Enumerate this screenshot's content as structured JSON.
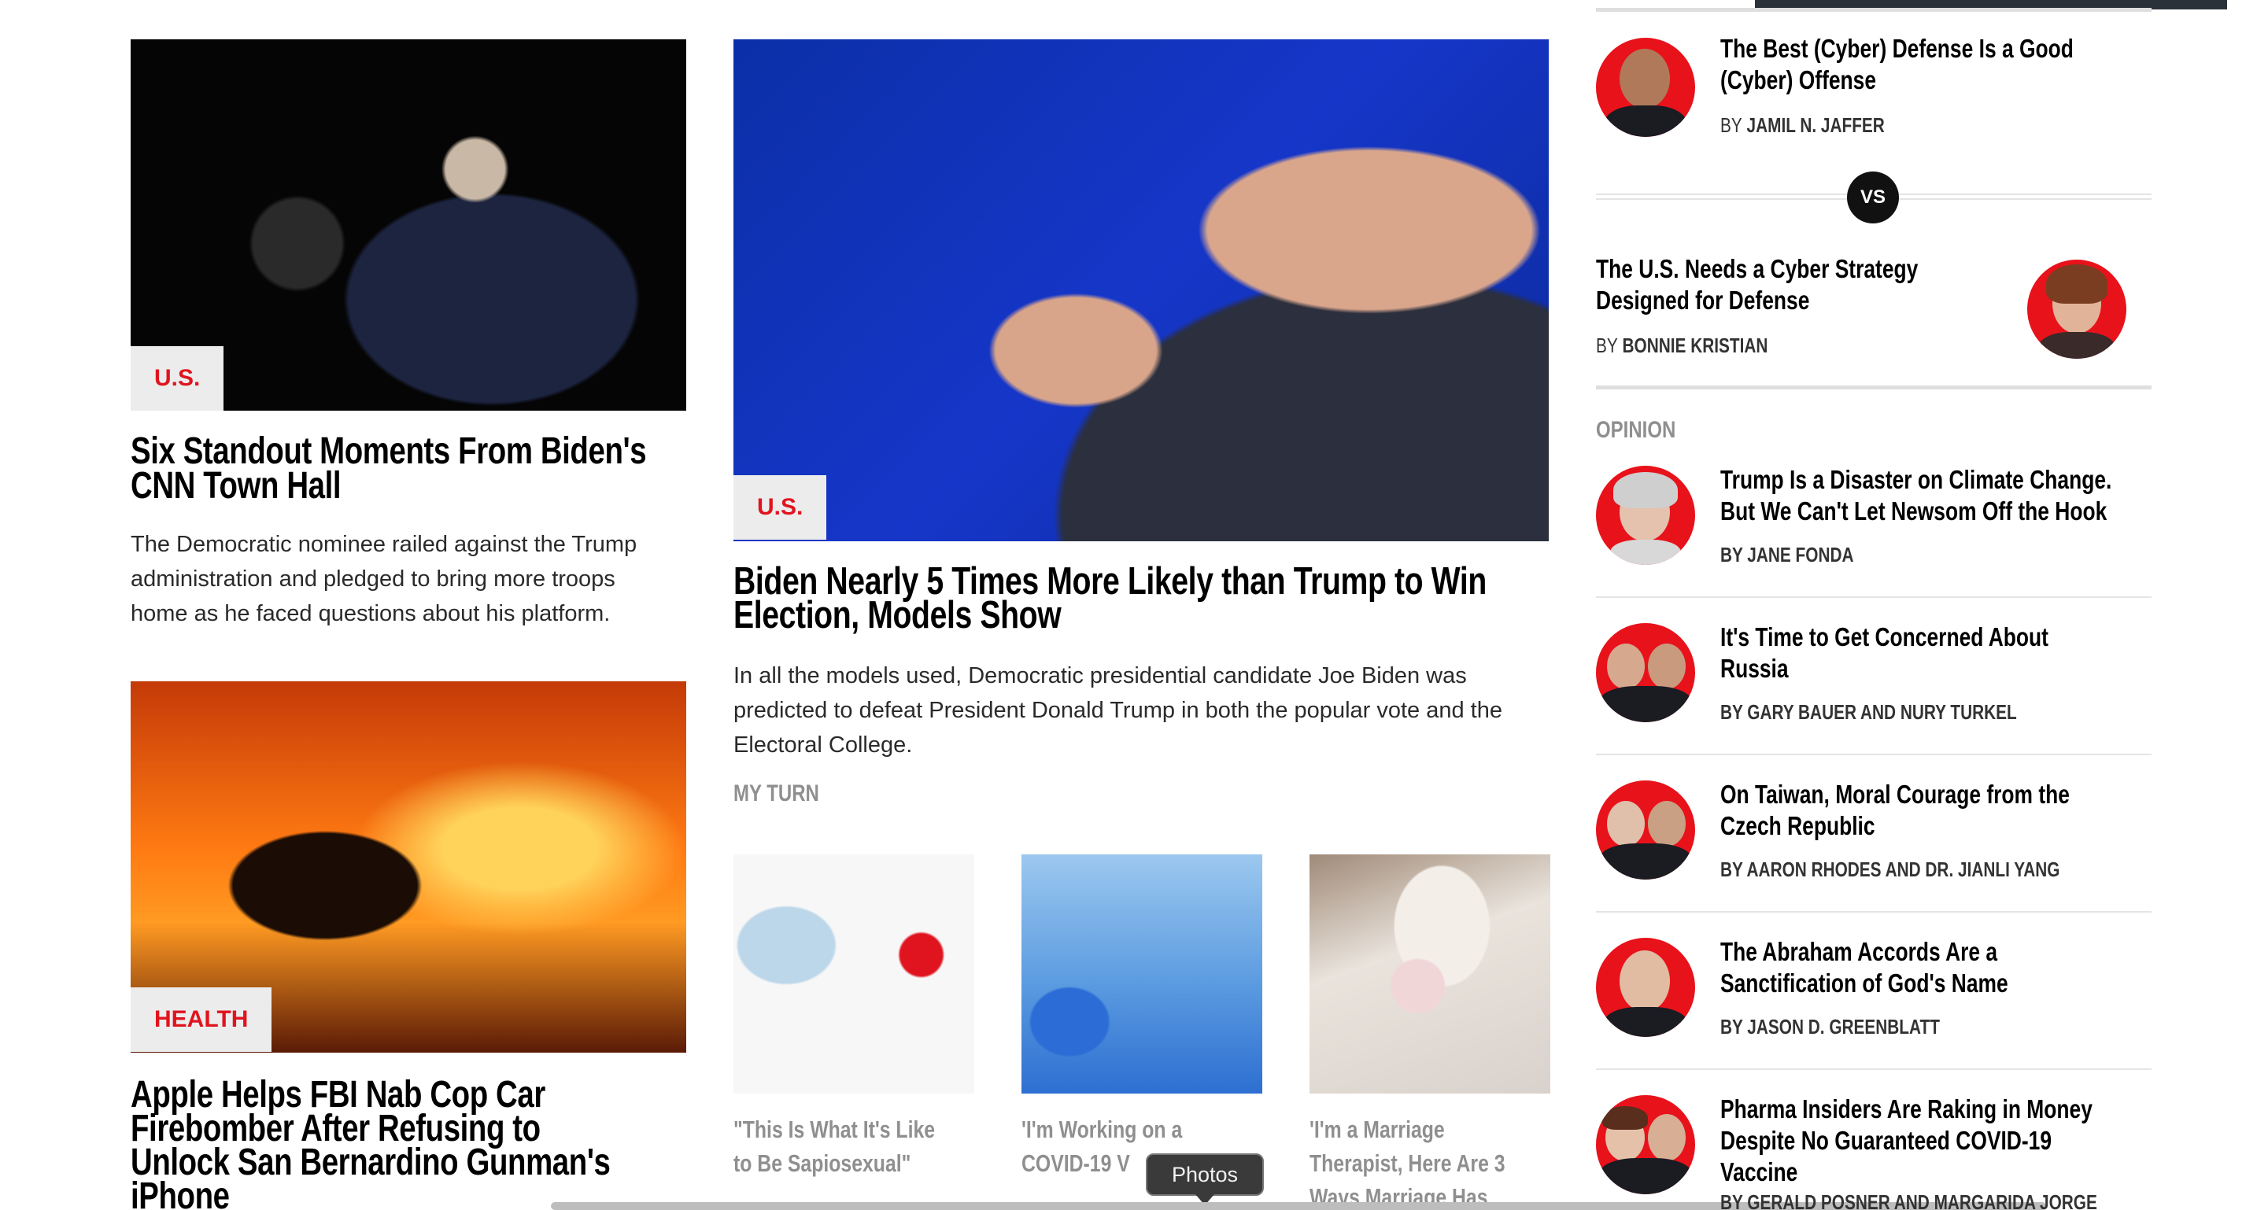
{
  "left_column": {
    "story1": {
      "tag": "U.S.",
      "headline_line1": "Six Standout Moments From Biden's",
      "headline_line2": "CNN Town Hall",
      "dek_line1": "The Democratic nominee railed against the Trump",
      "dek_line2": "administration and pledged to bring more troops",
      "dek_line3": "home as he faced questions about his platform."
    },
    "story2": {
      "tag": "HEALTH",
      "headline_line1": "Apple Helps FBI Nab Cop Car",
      "headline_line2": "Firebomber After Refusing to",
      "headline_line3": "Unlock San Bernardino Gunman's",
      "headline_line4": "iPhone"
    }
  },
  "center_column": {
    "lead": {
      "tag": "U.S.",
      "headline_line1": "Biden Nearly 5 Times More Likely than Trump to Win",
      "headline_line2": "Election, Models Show",
      "dek_line1": "In all the models used, Democratic presidential candidate Joe Biden was",
      "dek_line2": "predicted to defeat President Donald Trump in both the popular vote and the",
      "dek_line3": "Electoral College."
    },
    "section_label": "MY TURN",
    "my_turn": [
      {
        "line1": "\"This Is What It's Like",
        "line2": "to Be Sapiosexual\"",
        "line3": ""
      },
      {
        "line1": "'I'm Working on a",
        "line2": "COVID-19 V",
        "line3": ""
      },
      {
        "line1": "'I'm a Marriage",
        "line2": "Therapist, Here Are 3",
        "line3": "Ways Marriage Has"
      }
    ],
    "tooltip": "Photos"
  },
  "right_column": {
    "debate": {
      "pro": {
        "title_line1": "The Best (Cyber) Defense Is a Good",
        "title_line2": "(Cyber) Offense",
        "by": "BY",
        "author": "JAMIL N. JAFFER"
      },
      "vs": "VS",
      "con": {
        "title_line1": "The U.S. Needs a Cyber Strategy",
        "title_line2": "Designed for Defense",
        "by": "BY",
        "author": "BONNIE KRISTIAN"
      }
    },
    "opinion_label": "OPINION",
    "opinion_items": [
      {
        "line1": "Trump Is a Disaster on Climate Change.",
        "line2": "But We Can't Let Newsom Off the Hook",
        "line3": "",
        "byline": "BY JANE FONDA"
      },
      {
        "line1": "It's Time to Get Concerned About",
        "line2": "Russia",
        "line3": "",
        "byline": "BY GARY BAUER AND NURY TURKEL"
      },
      {
        "line1": "On Taiwan, Moral Courage from the",
        "line2": "Czech Republic",
        "line3": "",
        "byline": "BY AARON RHODES AND DR. JIANLI YANG"
      },
      {
        "line1": "The Abraham Accords Are a",
        "line2": "Sanctification of God's Name",
        "line3": "",
        "byline": "BY JASON D. GREENBLATT"
      },
      {
        "line1": "Pharma Insiders Are Raking in Money",
        "line2": "Despite No Guaranteed COVID-19",
        "line3": "Vaccine",
        "byline": "BY GERALD POSNER AND MARGARIDA JORGE"
      }
    ]
  },
  "colors": {
    "accent_red": "#e0141e",
    "tag_bg": "#ececec",
    "muted_grey": "#8f8f8f"
  }
}
